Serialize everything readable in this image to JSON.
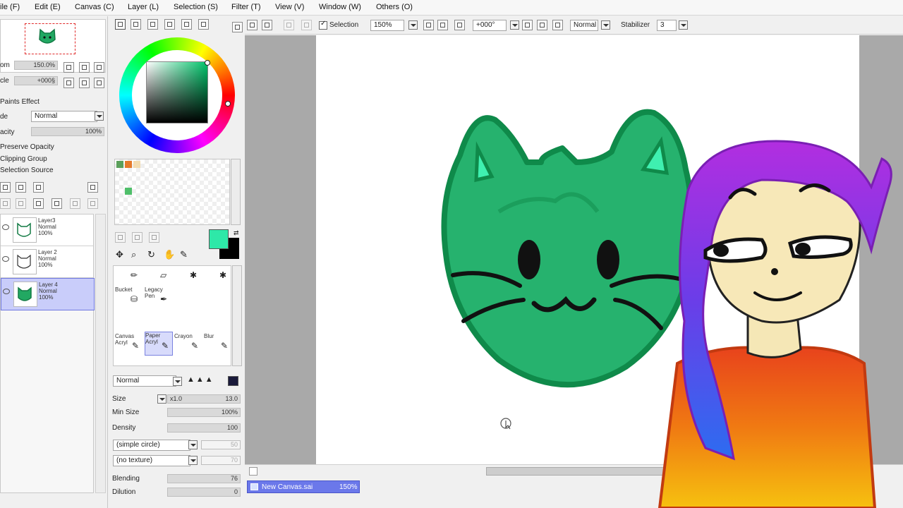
{
  "menubar": {
    "items": [
      "ile (F)",
      "Edit (E)",
      "Canvas (C)",
      "Layer (L)",
      "Selection (S)",
      "Filter (T)",
      "View (V)",
      "Window (W)",
      "Others (O)"
    ]
  },
  "navigator": {
    "zoom_label": "om",
    "zoom_value": "150.0%",
    "angle_label": "cle",
    "angle_value": "+000§"
  },
  "layer_props": {
    "section_title": "Paints Effect",
    "mode_label": "de",
    "mode_value": "Normal",
    "opacity_label": "acity",
    "opacity_value": "100%",
    "checks": [
      "Preserve Opacity",
      "Clipping Group",
      "Selection Source"
    ]
  },
  "layers": [
    {
      "name": "Layer3",
      "mode": "Normal",
      "opacity": "100%",
      "selected": false
    },
    {
      "name": "Layer 2",
      "mode": "Normal",
      "opacity": "100%",
      "selected": false
    },
    {
      "name": "Layer 4",
      "mode": "Normal",
      "opacity": "100%",
      "selected": true
    }
  ],
  "tools": {
    "row1": [
      "",
      "",
      "",
      ""
    ],
    "row2": [
      "Bucket",
      "Legacy Pen"
    ],
    "row3": [
      "Canvas Acryl",
      "Paper Acryl",
      "Crayon",
      "Blur"
    ]
  },
  "brush": {
    "mode_value": "Normal",
    "size_label": "Size",
    "size_mult": "x1.0",
    "size_value": "13.0",
    "min_size_label": "Min Size",
    "min_size_value": "100%",
    "density_label": "Density",
    "density_value": "100",
    "shape_value": "(simple circle)",
    "shape_strength": "50",
    "texture_value": "(no texture)",
    "texture_strength": "70",
    "blending_label": "Blending",
    "blending_value": "76",
    "dilution_label": "Dilution",
    "dilution_value": "0"
  },
  "colors": {
    "primary": "#2ee8a8",
    "secondary": "#000000",
    "palette": [
      "#5ba05b",
      "#e57a2a",
      "#f3dcb0",
      "#4fbf6a"
    ]
  },
  "canvas_toolbar": {
    "selection_label": "Selection",
    "zoom_value": "150%",
    "angle_value": "+000°",
    "mode_value": "Normal",
    "stabilizer_label": "Stabilizer",
    "stabilizer_value": "3"
  },
  "status": {
    "doc_name": "New Canvas.sai",
    "doc_zoom": "150%"
  }
}
